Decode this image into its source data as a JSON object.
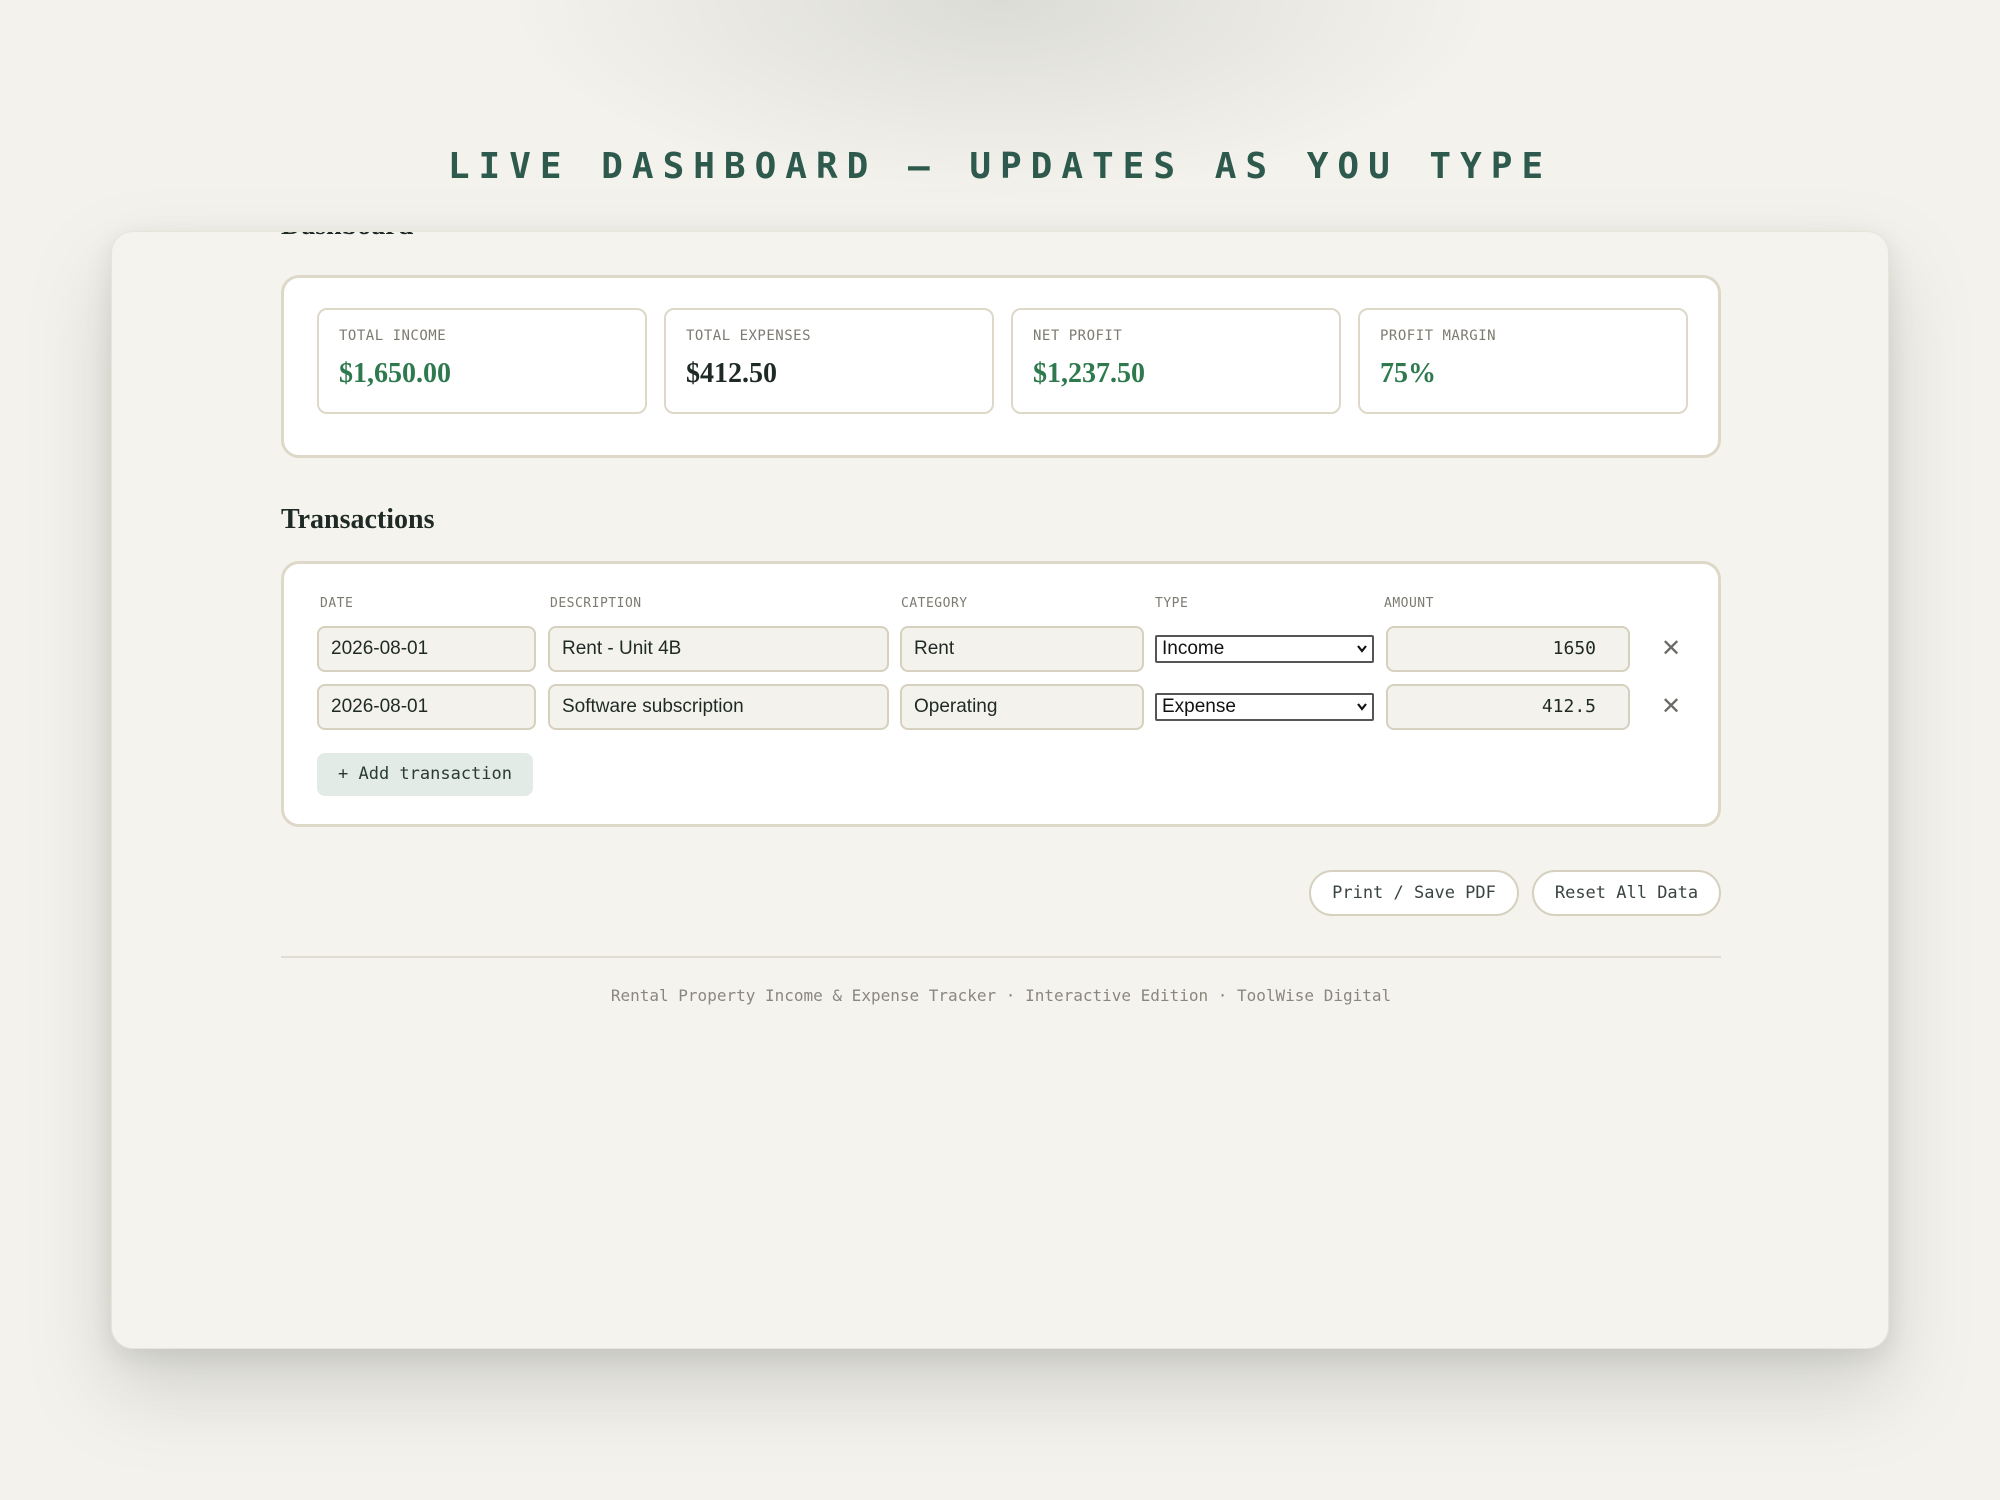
{
  "banner": "LIVE DASHBOARD — UPDATES AS YOU TYPE",
  "dashboard": {
    "heading": "Dashboard",
    "cards": [
      {
        "label": "TOTAL INCOME",
        "value": "$1,650.00"
      },
      {
        "label": "TOTAL EXPENSES",
        "value": "$412.50"
      },
      {
        "label": "NET PROFIT",
        "value": "$1,237.50"
      },
      {
        "label": "PROFIT MARGIN",
        "value": "75%"
      }
    ]
  },
  "transactions": {
    "heading": "Transactions",
    "columns": {
      "date": "DATE",
      "description": "DESCRIPTION",
      "category": "CATEGORY",
      "type": "TYPE",
      "amount": "AMOUNT"
    },
    "rows": [
      {
        "date": "2026-08-01",
        "description": "Rent - Unit 4B",
        "category": "Rent",
        "type": "Income",
        "amount": "1650"
      },
      {
        "date": "2026-08-01",
        "description": "Software subscription",
        "category": "Operating",
        "type": "Expense",
        "amount": "412.5"
      }
    ],
    "remove_symbol": "✕",
    "add_label": "+ Add transaction"
  },
  "actions": {
    "print_label": "Print / Save PDF",
    "reset_label": "Reset All Data"
  },
  "footer": "Rental Property Income & Expense Tracker · Interactive Edition · ToolWise Digital",
  "colors": {
    "accent": "#2e5a4e",
    "positive": "#2e7a4e",
    "panel_border": "#ddd8c8",
    "background": "#f4f2ed"
  }
}
